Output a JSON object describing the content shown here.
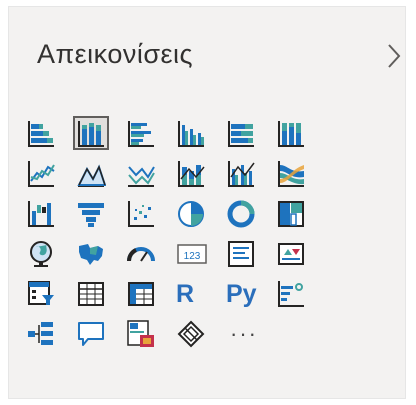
{
  "panel": {
    "title": "Απεικονίσεις",
    "collapse_icon": "chevron-right-icon"
  },
  "colors": {
    "blue": "#1e73be",
    "teal": "#41a3a0",
    "dark": "#252423",
    "panel_bg": "#f3f2f1"
  },
  "visuals": [
    {
      "id": "stacked-bar-chart"
    },
    {
      "id": "stacked-column-chart",
      "selected": true
    },
    {
      "id": "clustered-bar-chart"
    },
    {
      "id": "clustered-column-chart"
    },
    {
      "id": "100-stacked-bar-chart"
    },
    {
      "id": "100-stacked-column-chart"
    },
    {
      "id": "line-chart"
    },
    {
      "id": "area-chart"
    },
    {
      "id": "stacked-area-chart"
    },
    {
      "id": "line-and-stacked-column-chart"
    },
    {
      "id": "line-and-clustered-column-chart"
    },
    {
      "id": "ribbon-chart"
    },
    {
      "id": "waterfall-chart"
    },
    {
      "id": "funnel-chart"
    },
    {
      "id": "scatter-chart"
    },
    {
      "id": "pie-chart"
    },
    {
      "id": "donut-chart"
    },
    {
      "id": "treemap"
    },
    {
      "id": "map"
    },
    {
      "id": "filled-map"
    },
    {
      "id": "gauge"
    },
    {
      "id": "card",
      "text": "123"
    },
    {
      "id": "multi-row-card"
    },
    {
      "id": "kpi"
    },
    {
      "id": "slicer"
    },
    {
      "id": "table"
    },
    {
      "id": "matrix"
    },
    {
      "id": "r-script-visual",
      "text": "R"
    },
    {
      "id": "python-visual",
      "text": "Py"
    },
    {
      "id": "key-influencers"
    },
    {
      "id": "decomposition-tree"
    },
    {
      "id": "qa"
    },
    {
      "id": "paginated-report"
    },
    {
      "id": "power-apps"
    },
    {
      "id": "more-visuals",
      "text": "···"
    }
  ]
}
